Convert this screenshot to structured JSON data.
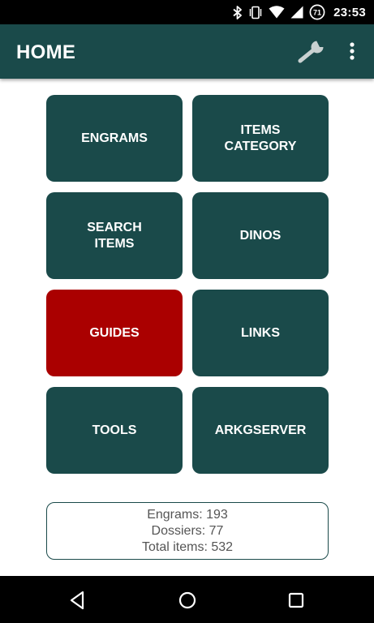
{
  "status_bar": {
    "time": "23:53",
    "battery_level": "71",
    "icons": [
      "bluetooth-icon",
      "vibrate-icon",
      "wifi-icon",
      "signal-icon",
      "battery-icon"
    ]
  },
  "app_bar": {
    "title": "HOME",
    "actions": [
      "wrench-icon",
      "overflow-menu-icon"
    ]
  },
  "tiles": [
    {
      "label": "ENGRAMS",
      "active": false
    },
    {
      "label": "ITEMS\nCATEGORY",
      "active": false
    },
    {
      "label": "SEARCH\nITEMS",
      "active": false
    },
    {
      "label": "DINOS",
      "active": false
    },
    {
      "label": "GUIDES",
      "active": true
    },
    {
      "label": "LINKS",
      "active": false
    },
    {
      "label": "TOOLS",
      "active": false
    },
    {
      "label": "ARKGSERVER",
      "active": false
    }
  ],
  "stats": {
    "engrams": "Engrams: 193",
    "dossiers": "Dossiers: 77",
    "total_items": "Total items: 532"
  },
  "colors": {
    "primary": "#1a4a4a",
    "active_tile": "#aa0000",
    "text_on_primary": "#ffffff"
  },
  "nav_bar": {
    "buttons": [
      "back-icon",
      "home-icon",
      "recents-icon"
    ]
  }
}
